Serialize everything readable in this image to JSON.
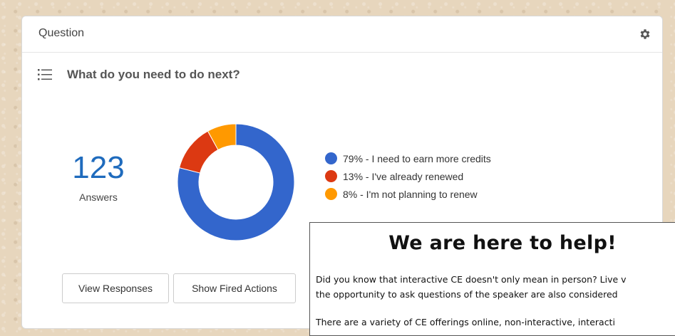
{
  "card": {
    "title": "Question",
    "settings_icon": "gear-icon"
  },
  "question": {
    "icon": "list-icon",
    "text": "What do you need to do next?"
  },
  "answers": {
    "count": "123",
    "label": "Answers"
  },
  "chart_data": {
    "type": "pie",
    "donut": true,
    "title": "",
    "categories": [
      "I need to earn more credits",
      "I've already renewed",
      "I'm not planning to renew"
    ],
    "values": [
      79,
      13,
      8
    ],
    "colors": [
      "#3366cc",
      "#dc3912",
      "#ff9900"
    ],
    "legend": [
      "79% - I need to earn more credits",
      "13% - I've already renewed",
      "8% - I'm not planning to renew"
    ],
    "legend_position": "right"
  },
  "buttons": {
    "view_responses": "View Responses",
    "show_fired_actions": "Show Fired Actions"
  },
  "popup": {
    "heading": "We are here to help!",
    "line1": "Did you know that interactive CE doesn't only mean in person? Live v",
    "line2": "the opportunity to ask questions of the speaker are also considered",
    "line3": "There are a variety of CE offerings online, non-interactive, interacti"
  }
}
